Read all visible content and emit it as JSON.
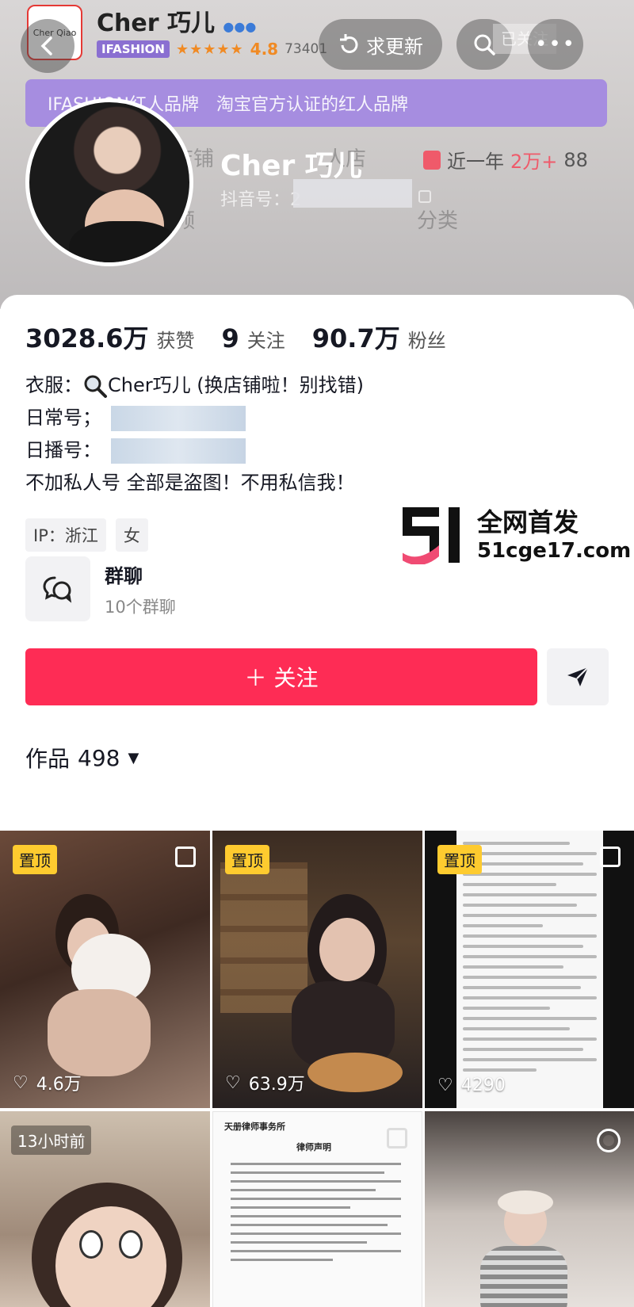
{
  "header": {
    "shop_name": "Cher 巧儿",
    "shop_logo_text": "Cher Qiao",
    "ifashion_badge": "IFASHION",
    "stars": "★★★★★",
    "rating": "4.8",
    "sold_count": "73401",
    "request_update_label": "求更新",
    "followed_label": "已关注",
    "purple_banner_text": [
      "IFASHION红人品牌",
      "淘宝官方认证的红人品牌"
    ],
    "faded_shop_label": "店铺",
    "faded_store_label": "人店",
    "faded_category_label": "分类",
    "faded_video_label": "频",
    "banner_name": "Cher 巧儿",
    "douyin_id_label": "抖音号：2",
    "year_stat_prefix": "近一年",
    "year_stat_value": "2万+",
    "year_stat_suffix": "88"
  },
  "profile": {
    "likes_value": "3028.6万",
    "likes_label": "获赞",
    "following_value": "9",
    "following_label": "关注",
    "followers_value": "90.7万",
    "followers_label": "粉丝",
    "bio_line1_prefix": "衣服：",
    "bio_line1_text": "Cher巧儿 (换店铺啦！别找错)",
    "bio_line2": "日常号；",
    "bio_line3": "日播号：",
    "bio_line4": "不加私人号 全部是盗图！不用私信我！",
    "tags": [
      "IP：浙江",
      "女"
    ]
  },
  "watermark": {
    "line1": "全网首发",
    "line2": "51cge17.com"
  },
  "group_chat": {
    "title": "群聊",
    "subtitle": "10个群聊"
  },
  "actions": {
    "follow_label": "＋ 关注"
  },
  "works": {
    "label": "作品",
    "count": "498",
    "tiles": [
      {
        "badge": "置顶",
        "likes": "4.6万"
      },
      {
        "badge": "置顶",
        "likes": "63.9万"
      },
      {
        "badge": "置顶",
        "likes": "4290"
      },
      {
        "badge": "13小时前",
        "likes": ""
      },
      {
        "badge": "",
        "likes": "",
        "doc_header": "天册律师事务所",
        "doc_title": "律师声明"
      },
      {
        "badge": "",
        "likes": ""
      }
    ]
  },
  "colors": {
    "accent": "#fe2c55",
    "pin_badge": "#fecb2f",
    "ifashion": "#8a6fd1",
    "rating": "#f08a24"
  }
}
